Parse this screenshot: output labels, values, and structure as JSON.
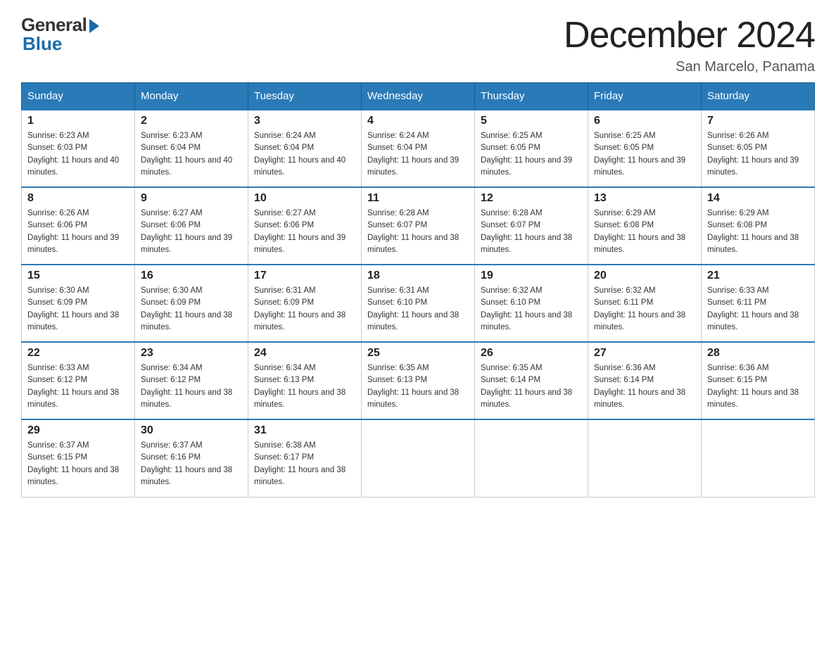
{
  "logo": {
    "general": "General",
    "blue": "Blue"
  },
  "title": "December 2024",
  "subtitle": "San Marcelo, Panama",
  "headers": [
    "Sunday",
    "Monday",
    "Tuesday",
    "Wednesday",
    "Thursday",
    "Friday",
    "Saturday"
  ],
  "weeks": [
    [
      {
        "day": "1",
        "sunrise": "6:23 AM",
        "sunset": "6:03 PM",
        "daylight": "11 hours and 40 minutes."
      },
      {
        "day": "2",
        "sunrise": "6:23 AM",
        "sunset": "6:04 PM",
        "daylight": "11 hours and 40 minutes."
      },
      {
        "day": "3",
        "sunrise": "6:24 AM",
        "sunset": "6:04 PM",
        "daylight": "11 hours and 40 minutes."
      },
      {
        "day": "4",
        "sunrise": "6:24 AM",
        "sunset": "6:04 PM",
        "daylight": "11 hours and 39 minutes."
      },
      {
        "day": "5",
        "sunrise": "6:25 AM",
        "sunset": "6:05 PM",
        "daylight": "11 hours and 39 minutes."
      },
      {
        "day": "6",
        "sunrise": "6:25 AM",
        "sunset": "6:05 PM",
        "daylight": "11 hours and 39 minutes."
      },
      {
        "day": "7",
        "sunrise": "6:26 AM",
        "sunset": "6:05 PM",
        "daylight": "11 hours and 39 minutes."
      }
    ],
    [
      {
        "day": "8",
        "sunrise": "6:26 AM",
        "sunset": "6:06 PM",
        "daylight": "11 hours and 39 minutes."
      },
      {
        "day": "9",
        "sunrise": "6:27 AM",
        "sunset": "6:06 PM",
        "daylight": "11 hours and 39 minutes."
      },
      {
        "day": "10",
        "sunrise": "6:27 AM",
        "sunset": "6:06 PM",
        "daylight": "11 hours and 39 minutes."
      },
      {
        "day": "11",
        "sunrise": "6:28 AM",
        "sunset": "6:07 PM",
        "daylight": "11 hours and 38 minutes."
      },
      {
        "day": "12",
        "sunrise": "6:28 AM",
        "sunset": "6:07 PM",
        "daylight": "11 hours and 38 minutes."
      },
      {
        "day": "13",
        "sunrise": "6:29 AM",
        "sunset": "6:08 PM",
        "daylight": "11 hours and 38 minutes."
      },
      {
        "day": "14",
        "sunrise": "6:29 AM",
        "sunset": "6:08 PM",
        "daylight": "11 hours and 38 minutes."
      }
    ],
    [
      {
        "day": "15",
        "sunrise": "6:30 AM",
        "sunset": "6:09 PM",
        "daylight": "11 hours and 38 minutes."
      },
      {
        "day": "16",
        "sunrise": "6:30 AM",
        "sunset": "6:09 PM",
        "daylight": "11 hours and 38 minutes."
      },
      {
        "day": "17",
        "sunrise": "6:31 AM",
        "sunset": "6:09 PM",
        "daylight": "11 hours and 38 minutes."
      },
      {
        "day": "18",
        "sunrise": "6:31 AM",
        "sunset": "6:10 PM",
        "daylight": "11 hours and 38 minutes."
      },
      {
        "day": "19",
        "sunrise": "6:32 AM",
        "sunset": "6:10 PM",
        "daylight": "11 hours and 38 minutes."
      },
      {
        "day": "20",
        "sunrise": "6:32 AM",
        "sunset": "6:11 PM",
        "daylight": "11 hours and 38 minutes."
      },
      {
        "day": "21",
        "sunrise": "6:33 AM",
        "sunset": "6:11 PM",
        "daylight": "11 hours and 38 minutes."
      }
    ],
    [
      {
        "day": "22",
        "sunrise": "6:33 AM",
        "sunset": "6:12 PM",
        "daylight": "11 hours and 38 minutes."
      },
      {
        "day": "23",
        "sunrise": "6:34 AM",
        "sunset": "6:12 PM",
        "daylight": "11 hours and 38 minutes."
      },
      {
        "day": "24",
        "sunrise": "6:34 AM",
        "sunset": "6:13 PM",
        "daylight": "11 hours and 38 minutes."
      },
      {
        "day": "25",
        "sunrise": "6:35 AM",
        "sunset": "6:13 PM",
        "daylight": "11 hours and 38 minutes."
      },
      {
        "day": "26",
        "sunrise": "6:35 AM",
        "sunset": "6:14 PM",
        "daylight": "11 hours and 38 minutes."
      },
      {
        "day": "27",
        "sunrise": "6:36 AM",
        "sunset": "6:14 PM",
        "daylight": "11 hours and 38 minutes."
      },
      {
        "day": "28",
        "sunrise": "6:36 AM",
        "sunset": "6:15 PM",
        "daylight": "11 hours and 38 minutes."
      }
    ],
    [
      {
        "day": "29",
        "sunrise": "6:37 AM",
        "sunset": "6:15 PM",
        "daylight": "11 hours and 38 minutes."
      },
      {
        "day": "30",
        "sunrise": "6:37 AM",
        "sunset": "6:16 PM",
        "daylight": "11 hours and 38 minutes."
      },
      {
        "day": "31",
        "sunrise": "6:38 AM",
        "sunset": "6:17 PM",
        "daylight": "11 hours and 38 minutes."
      },
      null,
      null,
      null,
      null
    ]
  ]
}
